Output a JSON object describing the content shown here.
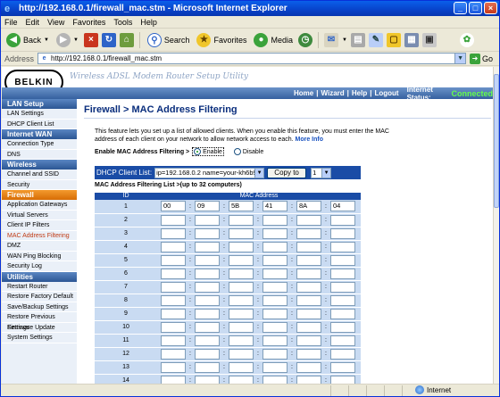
{
  "window": {
    "title": "http://192.168.0.1/firewall_mac.stm - Microsoft Internet Explorer"
  },
  "menu": [
    "File",
    "Edit",
    "View",
    "Favorites",
    "Tools",
    "Help"
  ],
  "toolbar": {
    "back_label": "Back",
    "search_label": "Search",
    "favorites_label": "Favorites",
    "media_label": "Media"
  },
  "address": {
    "label": "Address",
    "url": "http://192.168.0.1/firewall_mac.stm",
    "go_label": "Go"
  },
  "banner": {
    "logo": "BELKIN",
    "title": "Wireless ADSL Modem Router Setup Utility",
    "nav": [
      "Home",
      "Wizard",
      "Help",
      "Logout"
    ],
    "internet_status_label": "Internet Status:",
    "internet_status_value": "Connected"
  },
  "sidebar": {
    "sections": [
      {
        "title": "LAN Setup",
        "style": "blue",
        "items": [
          "LAN Settings",
          "DHCP Client List"
        ]
      },
      {
        "title": "Internet WAN",
        "style": "blue",
        "items": [
          "Connection Type",
          "DNS"
        ]
      },
      {
        "title": "Wireless",
        "style": "blue",
        "items": [
          "Channel and SSID",
          "Security"
        ]
      },
      {
        "title": "Firewall",
        "style": "orange",
        "items": [
          "Application Gateways",
          "Virtual Servers",
          "Client IP Filters",
          "MAC Address Filtering",
          "DMZ",
          "WAN Ping Blocking",
          "Security Log"
        ]
      },
      {
        "title": "Utilities",
        "style": "blue",
        "items": [
          "Restart Router",
          "Restore Factory Default",
          "Save/Backup Settings",
          "Restore Previous Settings",
          "Firmware Update",
          "System Settings"
        ]
      }
    ],
    "active_item": "MAC Address Filtering"
  },
  "main": {
    "title": "Firewall > MAC Address Filtering",
    "description": "This feature lets you set up a list of allowed clients. When you enable this feature, you must enter the MAC address of each client on your network to allow network access to each.",
    "more_info": "More Info",
    "enable_label": "Enable MAC Address Filtering >",
    "enable_option": "Enable",
    "disable_option": "Disable",
    "selected_option": "Enable",
    "dhcp_label": "DHCP Client List:",
    "dhcp_selected": "ip=192.168.0.2 name=your-kh6b9y4etp",
    "copy_button": "Copy to",
    "copy_target": "1",
    "list_label": "MAC Address Filtering List >(up to 32 computers)",
    "table": {
      "col_id": "ID",
      "col_mac": "MAC Address",
      "rows": [
        {
          "id": "1",
          "octets": [
            "00",
            "09",
            "5B",
            "41",
            "8A",
            "04"
          ]
        },
        {
          "id": "2",
          "octets": [
            "",
            "",
            "",
            "",
            "",
            ""
          ]
        },
        {
          "id": "3",
          "octets": [
            "",
            "",
            "",
            "",
            "",
            ""
          ]
        },
        {
          "id": "4",
          "octets": [
            "",
            "",
            "",
            "",
            "",
            ""
          ]
        },
        {
          "id": "5",
          "octets": [
            "",
            "",
            "",
            "",
            "",
            ""
          ]
        },
        {
          "id": "6",
          "octets": [
            "",
            "",
            "",
            "",
            "",
            ""
          ]
        },
        {
          "id": "7",
          "octets": [
            "",
            "",
            "",
            "",
            "",
            ""
          ]
        },
        {
          "id": "8",
          "octets": [
            "",
            "",
            "",
            "",
            "",
            ""
          ]
        },
        {
          "id": "9",
          "octets": [
            "",
            "",
            "",
            "",
            "",
            ""
          ]
        },
        {
          "id": "10",
          "octets": [
            "",
            "",
            "",
            "",
            "",
            ""
          ]
        },
        {
          "id": "11",
          "octets": [
            "",
            "",
            "",
            "",
            "",
            ""
          ]
        },
        {
          "id": "12",
          "octets": [
            "",
            "",
            "",
            "",
            "",
            ""
          ]
        },
        {
          "id": "13",
          "octets": [
            "",
            "",
            "",
            "",
            "",
            ""
          ]
        },
        {
          "id": "14",
          "octets": [
            "",
            "",
            "",
            "",
            "",
            ""
          ]
        }
      ]
    }
  },
  "statusbar": {
    "zone": "Internet"
  }
}
